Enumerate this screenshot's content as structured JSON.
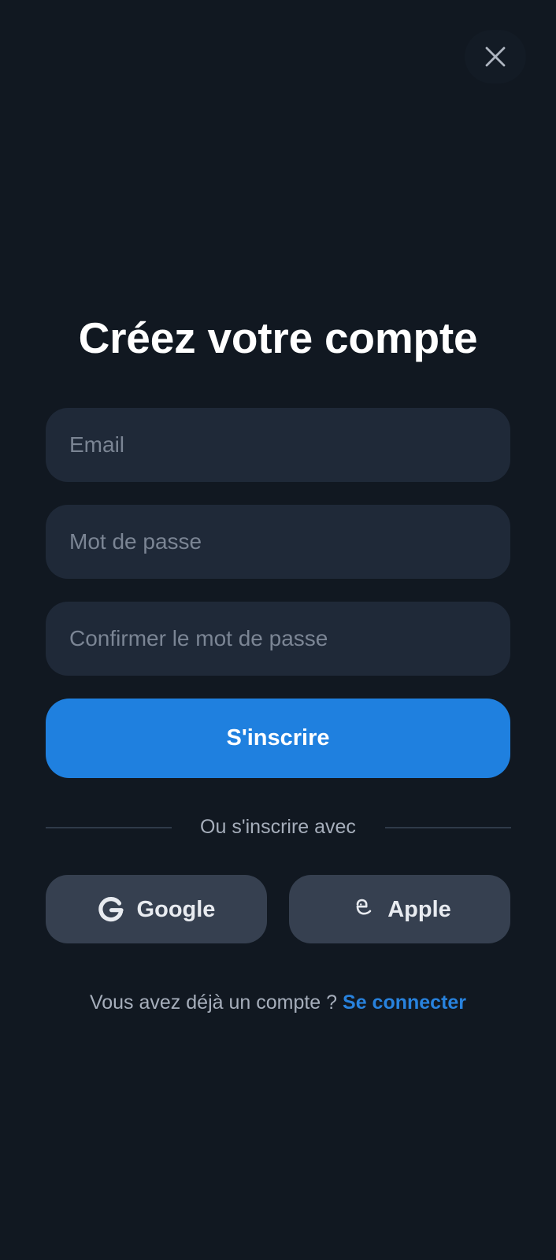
{
  "title": "Créez votre compte",
  "fields": {
    "email_placeholder": "Email",
    "password_placeholder": "Mot de passe",
    "confirm_password_placeholder": "Confirmer le mot de passe"
  },
  "primary_button": {
    "label": "S'inscrire"
  },
  "divider": {
    "text": "Ou s'inscrire avec"
  },
  "social": {
    "google_label": "Google",
    "apple_label": "Apple",
    "google_icon": "google-g-icon",
    "apple_icon": "apple-logo-icon"
  },
  "footer": {
    "prompt": "Vous avez déjà un compte ?",
    "link_label": "Se connecter"
  },
  "icons": {
    "close": "close-icon"
  },
  "colors": {
    "background": "#111821",
    "field_background": "#1f2938",
    "primary": "#1f80df",
    "social_background": "#364050",
    "link": "#2882dd"
  }
}
